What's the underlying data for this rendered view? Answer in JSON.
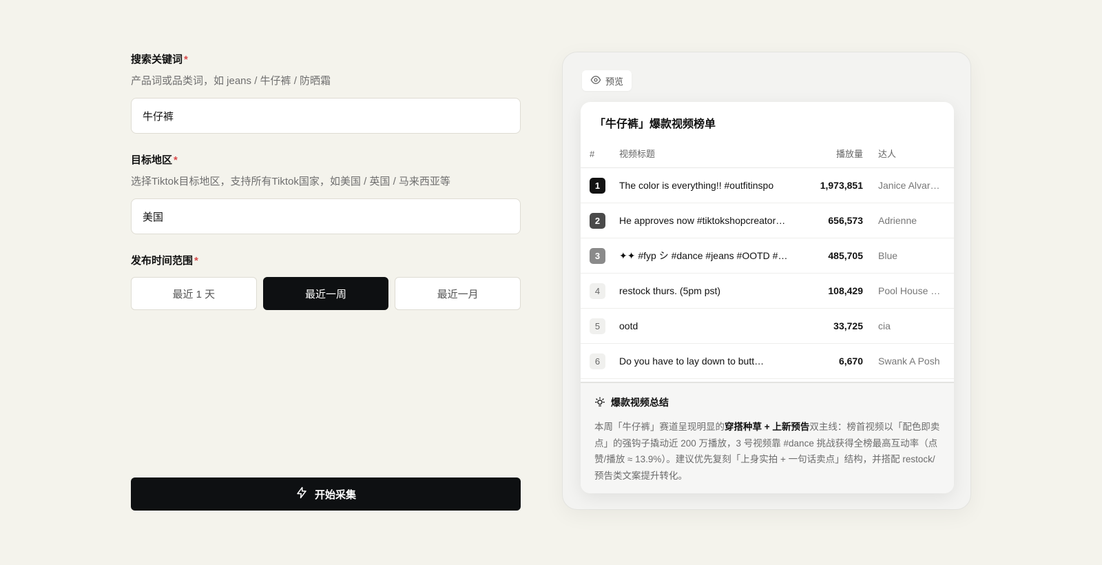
{
  "form": {
    "keyword": {
      "label": "搜索关键词",
      "required_mark": "*",
      "hint": "产品词或品类词，如 jeans / 牛仔裤 / 防晒霜",
      "value": "牛仔裤"
    },
    "region": {
      "label": "目标地区",
      "required_mark": "*",
      "hint": "选择Tiktok目标地区，支持所有Tiktok国家，如美国 / 英国 / 马来西亚等",
      "value": "美国"
    },
    "time_range": {
      "label": "发布时间范围",
      "required_mark": "*",
      "options": [
        "最近 1 天",
        "最近一周",
        "最近一月"
      ],
      "selected": "最近一周"
    },
    "start_button": "开始采集"
  },
  "preview": {
    "tag": "预览",
    "card_title": "「牛仔裤」爆款视频榜单",
    "columns": {
      "rank": "#",
      "title": "视频标题",
      "plays": "播放量",
      "creator": "达人"
    },
    "rows": [
      {
        "rank": "1",
        "title": "The color is everything!! #outfitinspo",
        "plays": "1,973,851",
        "creator": "Janice Alvar…"
      },
      {
        "rank": "2",
        "title": "He approves now #tiktokshopcreator…",
        "plays": "656,573",
        "creator": "Adrienne"
      },
      {
        "rank": "3",
        "title": "✦✦ #fyp シ #dance #jeans #OOTD #…",
        "plays": "485,705",
        "creator": "Blue"
      },
      {
        "rank": "4",
        "title": "restock thurs. (5pm pst)",
        "plays": "108,429",
        "creator": "Pool House …"
      },
      {
        "rank": "5",
        "title": "ootd",
        "plays": "33,725",
        "creator": "cia"
      },
      {
        "rank": "6",
        "title": "Do you have to lay down to butt…",
        "plays": "6,670",
        "creator": "Swank A Posh"
      }
    ],
    "summary": {
      "title": "爆款视频总结",
      "text_1": "本周「牛仔裤」赛道呈现明显的",
      "text_bold": "穿搭种草 + 上新预告",
      "text_2": "双主线：榜首视频以「配色即卖点」的强钩子撬动近 200 万播放，3 号视频靠 #dance 挑战获得全榜最高互动率（点赞/播放 ≈ 13.9%）。建议优先复刻「上身实拍 + 一句话卖点」结构，并搭配 restock/预告类文案提升转化。"
    }
  },
  "colors": {
    "background": "#f4f3ec",
    "primary_dark": "#0e1012",
    "required": "#d94a4a"
  },
  "icons": {
    "preview_tag": "eye-icon",
    "start_button": "lightning-icon",
    "summary": "lightbulb-icon"
  }
}
